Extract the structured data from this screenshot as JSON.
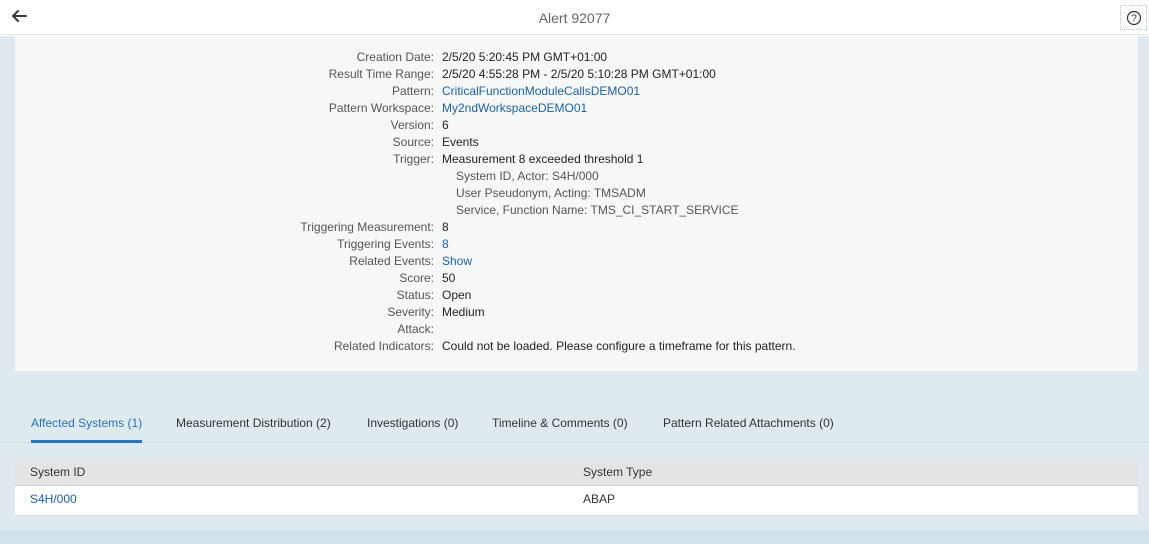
{
  "header": {
    "title": "Alert 92077",
    "back_icon": "back-arrow-icon",
    "help_icon": "help-circle-icon"
  },
  "details": {
    "creation_date": {
      "label": "Creation Date:",
      "value": "2/5/20 5:20:45 PM GMT+01:00"
    },
    "result_time_range": {
      "label": "Result Time Range:",
      "value": "2/5/20 4:55:28 PM - 2/5/20 5:10:28 PM GMT+01:00"
    },
    "pattern": {
      "label": "Pattern:",
      "value": "CriticalFunctionModuleCallsDEMO01"
    },
    "pattern_workspace": {
      "label": "Pattern Workspace:",
      "value": "My2ndWorkspaceDEMO01"
    },
    "version": {
      "label": "Version:",
      "value": "6"
    },
    "source": {
      "label": "Source:",
      "value": "Events"
    },
    "trigger": {
      "label": "Trigger:",
      "value": "Measurement 8 exceeded threshold 1",
      "lines": [
        "System ID, Actor: S4H/000",
        "User Pseudonym, Acting: TMSADM",
        "Service, Function Name: TMS_CI_START_SERVICE"
      ]
    },
    "triggering_measurement": {
      "label": "Triggering Measurement:",
      "value": "8"
    },
    "triggering_events": {
      "label": "Triggering Events:",
      "value": "8"
    },
    "related_events": {
      "label": "Related Events:",
      "value": "Show"
    },
    "score": {
      "label": "Score:",
      "value": "50"
    },
    "status": {
      "label": "Status:",
      "value": "Open"
    },
    "severity": {
      "label": "Severity:",
      "value": "Medium"
    },
    "attack": {
      "label": "Attack:",
      "value": ""
    },
    "related_indicators": {
      "label": "Related Indicators:",
      "value": "Could not be loaded. Please configure a timeframe for this pattern."
    }
  },
  "tabs": [
    {
      "label": "Affected Systems (1)",
      "active": true
    },
    {
      "label": "Measurement Distribution (2)",
      "active": false
    },
    {
      "label": "Investigations (0)",
      "active": false
    },
    {
      "label": "Timeline & Comments (0)",
      "active": false
    },
    {
      "label": "Pattern Related Attachments (0)",
      "active": false
    }
  ],
  "table": {
    "columns": [
      "System ID",
      "System Type"
    ],
    "rows": [
      [
        "S4H/000",
        "ABAP"
      ]
    ]
  },
  "colors": {
    "link": "#1f5f9e",
    "active_tab": "#2d72b4",
    "content_bg": "#dfeaef",
    "panel_bg": "#f6f8f8"
  }
}
